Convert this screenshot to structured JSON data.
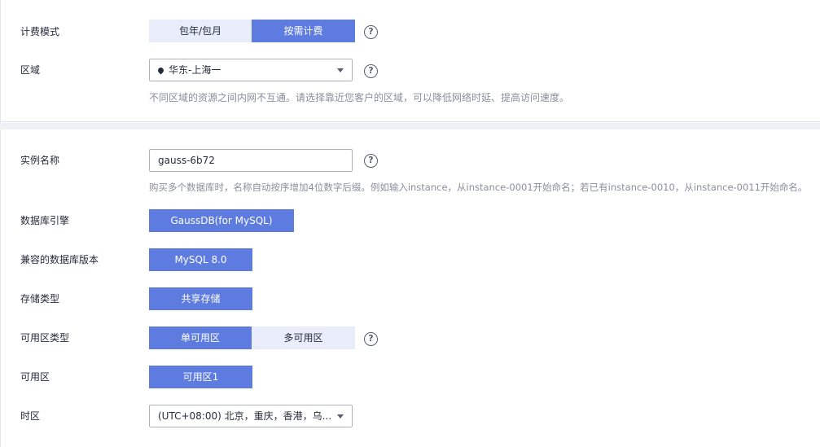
{
  "billing": {
    "label": "计费模式",
    "options": [
      "包年/包月",
      "按需计费"
    ],
    "selected": 1
  },
  "region": {
    "label": "区域",
    "value": "华东-上海一",
    "hint": "不同区域的资源之间内网不互通。请选择靠近您客户的区域，可以降低网络时延、提高访问速度。"
  },
  "instance_name": {
    "label": "实例名称",
    "value": "gauss-6b72",
    "hint": "购买多个数据库时，名称自动按序增加4位数字后缀。例如输入instance，从instance-0001开始命名；若已有instance-0010，从instance-0011开始命名。"
  },
  "engine": {
    "label": "数据库引擎",
    "value": "GaussDB(for MySQL)"
  },
  "version": {
    "label": "兼容的数据库版本",
    "value": "MySQL 8.0"
  },
  "storage": {
    "label": "存储类型",
    "value": "共享存储"
  },
  "az_type": {
    "label": "可用区类型",
    "options": [
      "单可用区",
      "多可用区"
    ],
    "selected": 0
  },
  "az": {
    "label": "可用区",
    "value": "可用区1"
  },
  "timezone": {
    "label": "时区",
    "value": "(UTC+08:00) 北京，重庆，香港，乌..."
  },
  "help_glyph": "?",
  "colors": {
    "accent": "#5e7ce0",
    "inactive": "#e9edfa"
  }
}
